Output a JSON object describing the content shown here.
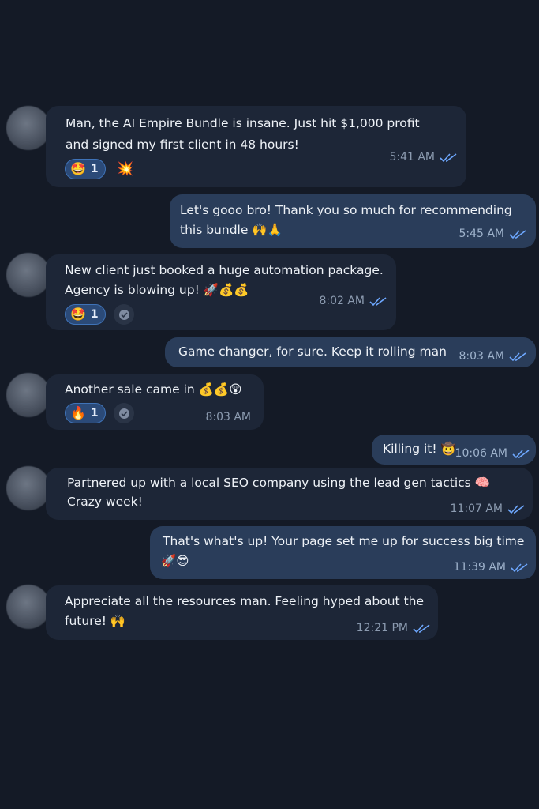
{
  "messages": [
    {
      "id": "m1",
      "direction": "incoming",
      "line1": "Man, the AI Empire Bundle is insane. Just hit $1,000 profit",
      "line2": "and signed my first client in 48 hours!",
      "time": "5:41 AM",
      "reaction": {
        "emoji": "🤩",
        "count": "1"
      },
      "extra_emoji": "💥"
    },
    {
      "id": "m2",
      "direction": "outgoing",
      "line1": "Let's gooo bro! Thank you so much for recommending",
      "line2": "this bundle 🙌🙏",
      "time": "5:45 AM"
    },
    {
      "id": "m3",
      "direction": "incoming",
      "line1": "New client just booked a huge automation package.",
      "line2": "Agency is blowing up! 🚀💰💰",
      "time": "8:02 AM",
      "reaction": {
        "emoji": "🤩",
        "count": "1"
      }
    },
    {
      "id": "m4",
      "direction": "outgoing",
      "line1": "Game changer, for sure. Keep it rolling man",
      "time": "8:03 AM"
    },
    {
      "id": "m5",
      "direction": "incoming",
      "line1": "Another sale came in 💰💰😲",
      "time": "8:03 AM",
      "reaction": {
        "emoji": "🔥",
        "count": "1"
      }
    },
    {
      "id": "m6",
      "direction": "outgoing",
      "line1": "Killing it! 🤠",
      "time": "10:06 AM"
    },
    {
      "id": "m7",
      "direction": "incoming",
      "line1": "Partnered up with a local SEO company using the lead gen tactics 🧠",
      "line2": "Crazy week!",
      "time": "11:07 AM"
    },
    {
      "id": "m8",
      "direction": "outgoing",
      "line1": "That's what's up! Your page set me up for success big time",
      "line2": "🚀😎",
      "time": "11:39 AM"
    },
    {
      "id": "m9",
      "direction": "incoming",
      "line1": "Appreciate all the resources man. Feeling hyped about the",
      "line2": "future! 🙌",
      "time": "12:21 PM"
    }
  ],
  "icons": {
    "read_receipt": "double-check-icon",
    "seen_badge": "check-circle-icon",
    "avatar": "avatar"
  },
  "colors": {
    "background": "#141a26",
    "incoming_bubble": "#1d2637",
    "outgoing_bubble": "#2a3d5a",
    "reaction_chip": "#2b4a78",
    "check": "#6ea8ff"
  }
}
